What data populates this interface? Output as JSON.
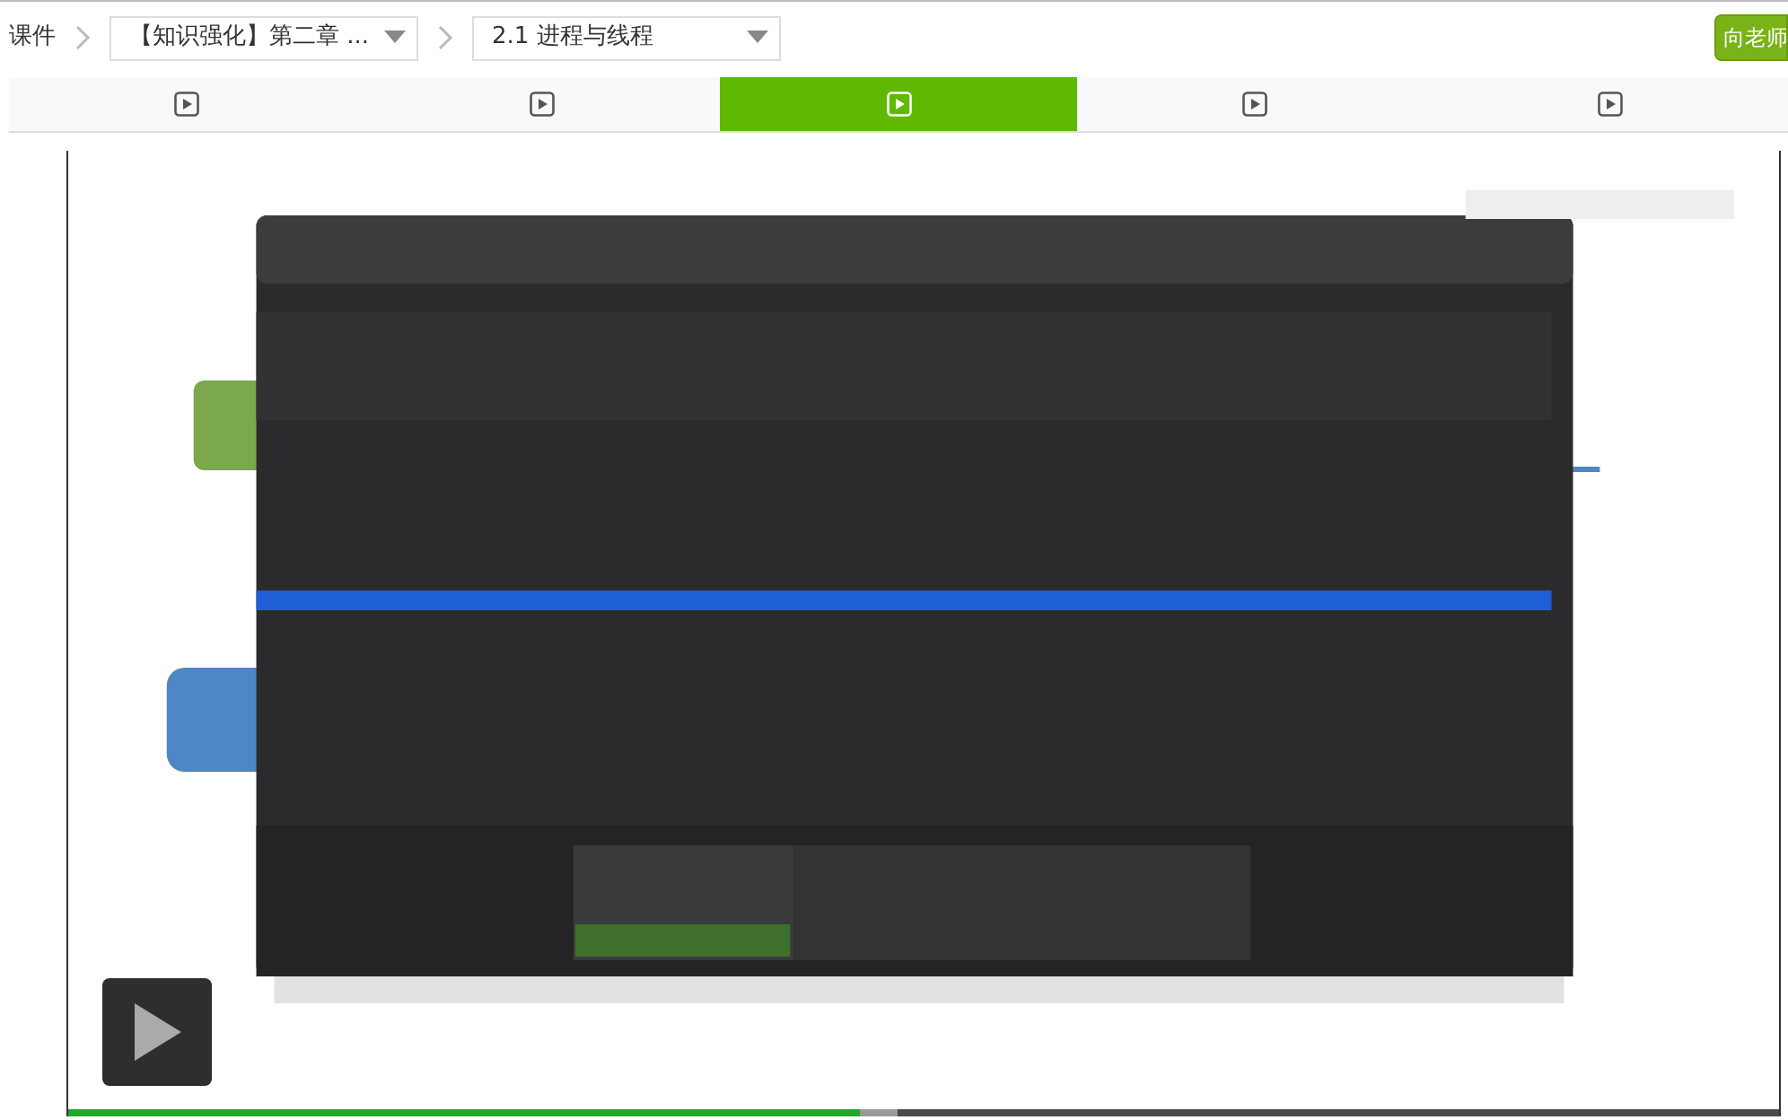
{
  "breadcrumb": {
    "root": "课件",
    "selects": [
      {
        "value": "【知识强化】第二章 ..."
      },
      {
        "value": "2.1 进程与线程"
      }
    ]
  },
  "ask_button": "向老师",
  "tabs": [
    {
      "selected": false
    },
    {
      "selected": false
    },
    {
      "selected": true
    },
    {
      "selected": false
    },
    {
      "selected": false
    }
  ],
  "player": {
    "progress": {
      "level": 0.463
    },
    "buffer": {
      "level": 0.485
    }
  }
}
